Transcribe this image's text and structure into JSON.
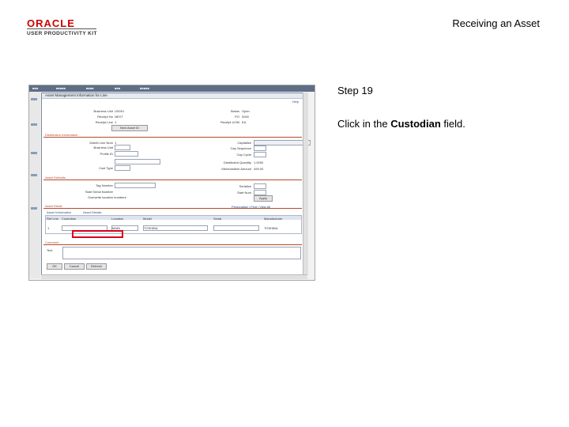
{
  "header": {
    "logo_oracle": "ORACLE",
    "logo_subtitle": "USER PRODUCTIVITY KIT",
    "title": "Receiving an Asset"
  },
  "step": {
    "label": "Step 19",
    "instruction_prefix": "Click in the ",
    "instruction_field": "Custodian",
    "instruction_suffix": " field."
  },
  "screenshot": {
    "modal_title": "Asset Management Information for Line",
    "help_link": "Help",
    "header_fields": {
      "business_unit_label": "Business Unit",
      "business_unit_value": "US001",
      "status_label": "Status",
      "status_value": "Open",
      "receipt_no_label": "Receipt No",
      "receipt_no_value": "NEXT",
      "po_label": "PO",
      "po_value": "0000",
      "receipt_line_label": "Receipt Line",
      "receipt_line_value": "1",
      "receipt_uom_label": "Receipt UOM",
      "receipt_uom_value": "EA",
      "next_asset_button": "Next Asset ID"
    },
    "sections": {
      "distribution": "Distribution Information",
      "asset_defaults": "Asset Defaults",
      "asset_detail": "Asset Detail",
      "comment": "Comment"
    },
    "distribution_fields": {
      "dist_line_label": "Distrib Line Num",
      "dist_line_value": "1",
      "capitalize_label": "Capitalize",
      "business_unit_label": "Business Unit",
      "cap_sequence_label": "Cap Sequence",
      "profile_label": "Profile ID",
      "cap_cycle_label": "Cap Cycle",
      "cost_type_label": "Cost Type",
      "dist_qty_label": "Distributed Quantity",
      "dist_qty_value": "1.0000",
      "merch_amt_label": "Merchandise Amount",
      "merch_amt_value": "499.00"
    },
    "defaults_fields": {
      "tag_label": "Tag Number",
      "start_serial_label": "Start Serial Number",
      "serialize_label": "Serialize",
      "start_num_label": "Start Num",
      "overwrite_label": "Overwrite location numbers",
      "apply_button": "Apply"
    },
    "grid": {
      "tabs": [
        "Asset Information",
        "Asset Details"
      ],
      "nav": "Personalize | Find | View All",
      "columns": [
        "Ref Line",
        "Custodian",
        "Location",
        "Model",
        "Serial",
        "Manufacturer"
      ],
      "row": [
        "1",
        "",
        "MAIN",
        "TOSHIBA",
        "",
        "TOSHIBA"
      ]
    },
    "comment_label": "Text",
    "buttons": {
      "ok": "OK",
      "cancel": "Cancel",
      "refresh": "Refresh"
    }
  }
}
